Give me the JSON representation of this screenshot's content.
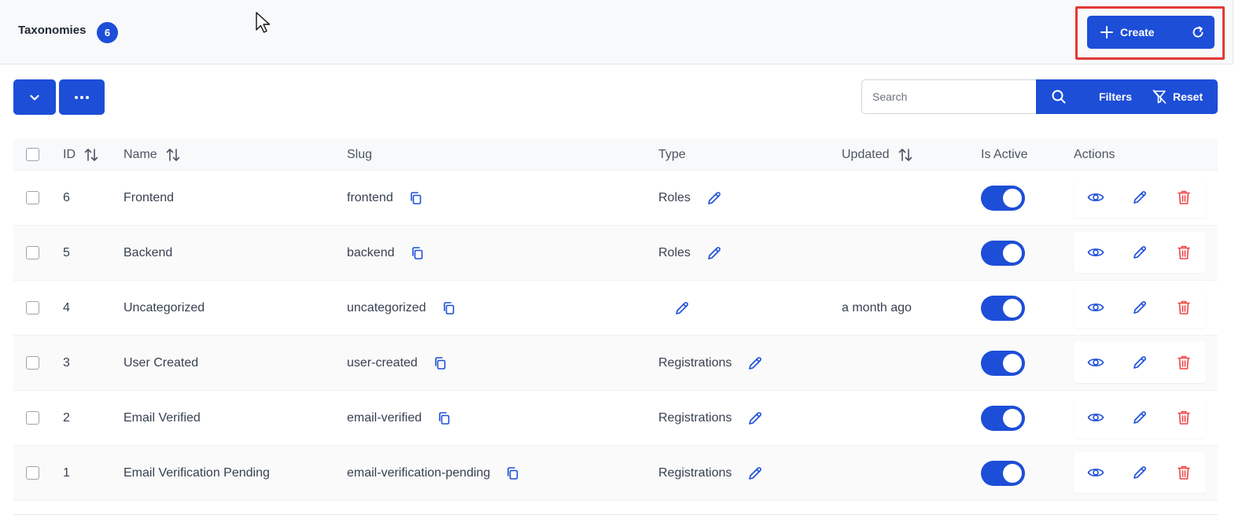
{
  "header": {
    "title": "Taxonomies",
    "count": "6",
    "create_label": "Create"
  },
  "toolbar": {
    "search_placeholder": "Search",
    "filters_label": "Filters",
    "reset_label": "Reset"
  },
  "table": {
    "columns": {
      "id": "ID",
      "name": "Name",
      "slug": "Slug",
      "type": "Type",
      "updated": "Updated",
      "is_active": "Is Active",
      "actions": "Actions"
    },
    "rows": [
      {
        "id": "6",
        "name": "Frontend",
        "slug": "frontend",
        "type": "Roles",
        "updated": "",
        "active": true
      },
      {
        "id": "5",
        "name": "Backend",
        "slug": "backend",
        "type": "Roles",
        "updated": "",
        "active": true
      },
      {
        "id": "4",
        "name": "Uncategorized",
        "slug": "uncategorized",
        "type": "",
        "updated": "a month ago",
        "active": true
      },
      {
        "id": "3",
        "name": "User Created",
        "slug": "user-created",
        "type": "Registrations",
        "updated": "",
        "active": true
      },
      {
        "id": "2",
        "name": "Email Verified",
        "slug": "email-verified",
        "type": "Registrations",
        "updated": "",
        "active": true
      },
      {
        "id": "1",
        "name": "Email Verification Pending",
        "slug": "email-verification-pending",
        "type": "Registrations",
        "updated": "",
        "active": true
      }
    ]
  },
  "colors": {
    "primary": "#1d4ed8",
    "danger": "#ef4444",
    "highlight": "#e53935"
  }
}
